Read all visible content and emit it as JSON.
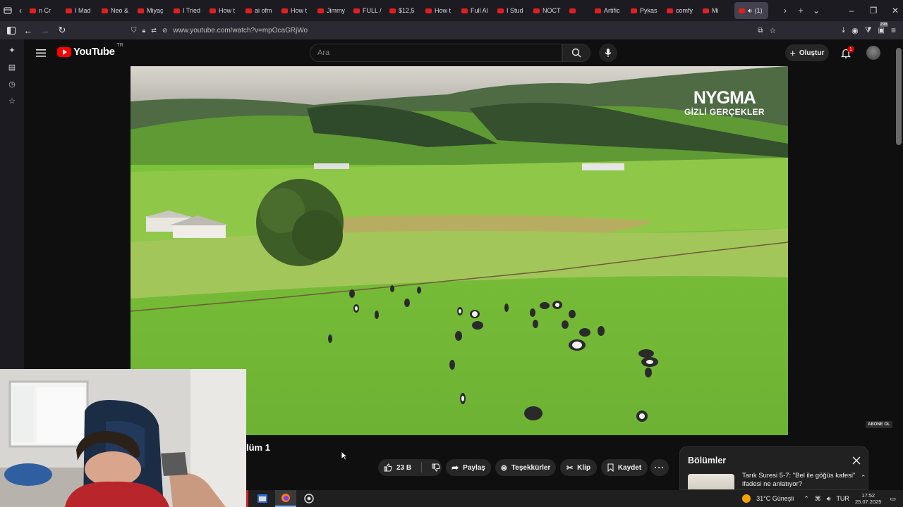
{
  "browser": {
    "tabs": [
      {
        "label": "n Cr"
      },
      {
        "label": "I Mad"
      },
      {
        "label": "Neo &"
      },
      {
        "label": "Miyaç"
      },
      {
        "label": "I Tried"
      },
      {
        "label": "How t"
      },
      {
        "label": "ai ofm"
      },
      {
        "label": "How t"
      },
      {
        "label": "Jimmy"
      },
      {
        "label": "FULL /"
      },
      {
        "label": "$12,5"
      },
      {
        "label": "How t"
      },
      {
        "label": "Full Al"
      },
      {
        "label": "I Stud"
      },
      {
        "label": "NOCT"
      },
      {
        "label": ""
      },
      {
        "label": "Artific"
      },
      {
        "label": "Pykas"
      },
      {
        "label": "comfy"
      },
      {
        "label": "Mi"
      },
      {
        "label": "(1)"
      }
    ],
    "url": "www.youtube.com/watch?v=mpOcaGRjWo",
    "extension_badge": "298"
  },
  "youtube": {
    "logo_text": "YouTube",
    "country_code": "TR",
    "search_placeholder": "Ara",
    "create_label": "Oluştur",
    "notification_count": "1",
    "video": {
      "watermark_line1": "NYGMA",
      "watermark_line2": "GİZLİ GERÇEKLER",
      "subscribe_badge": "ABONE OL"
    },
    "title_fragment": "lüm 1",
    "actions": {
      "like_count": "23 B",
      "share": "Paylaş",
      "thanks": "Teşekkürler",
      "clip": "Klip",
      "save": "Kaydet"
    },
    "chapters": {
      "heading": "Bölümler",
      "item_text": "Tarık Suresi 5-7: \"Bel ile göğüs kafesi\" ifadesi ne anlatıyor?"
    }
  },
  "taskbar": {
    "weather": "31°C  Güneşli",
    "language": "TUR",
    "time": "17:52",
    "date": "25.07.2025"
  },
  "colors": {
    "youtube_red": "#ff0000",
    "background": "#0f0f0f",
    "chip": "#272727"
  }
}
